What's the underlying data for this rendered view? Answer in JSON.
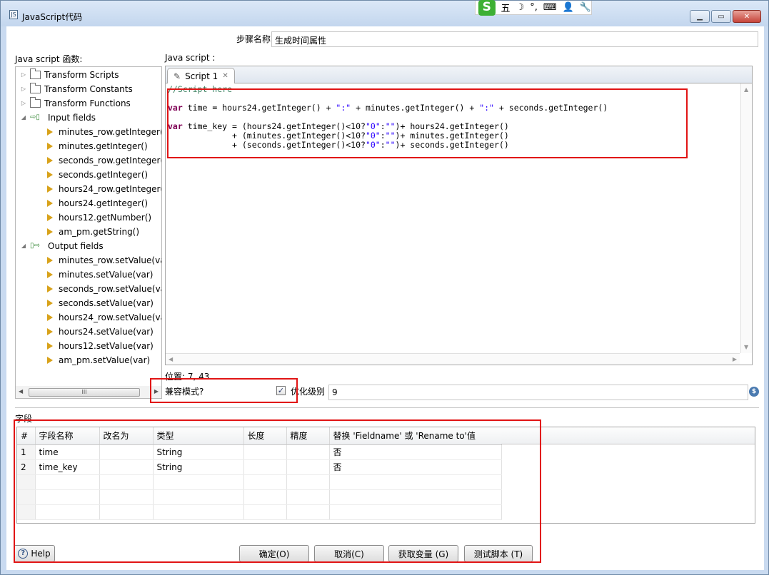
{
  "window": {
    "title": "JavaScript代码",
    "controls": [
      "minimize-icon",
      "maximize-icon",
      "close-icon"
    ]
  },
  "ime_toolbar": {
    "logo": "S",
    "items": [
      "五",
      "☽",
      "°,",
      "⌨",
      "👤",
      "🔧"
    ]
  },
  "step": {
    "label": "步骤名称",
    "value": "生成时间属性"
  },
  "functions_panel": {
    "label": "Java script 函数:",
    "tree": [
      {
        "label": "Transform Scripts",
        "level": 0,
        "kind": "folder",
        "expanded": false
      },
      {
        "label": "Transform Constants",
        "level": 0,
        "kind": "folder",
        "expanded": false
      },
      {
        "label": "Transform Functions",
        "level": 0,
        "kind": "folder",
        "expanded": false
      },
      {
        "label": "Input fields",
        "level": 0,
        "kind": "input",
        "expanded": true
      },
      {
        "label": "minutes_row.getInteger(",
        "level": 1,
        "kind": "leaf"
      },
      {
        "label": "minutes.getInteger()",
        "level": 1,
        "kind": "leaf"
      },
      {
        "label": "seconds_row.getInteger(",
        "level": 1,
        "kind": "leaf"
      },
      {
        "label": "seconds.getInteger()",
        "level": 1,
        "kind": "leaf"
      },
      {
        "label": "hours24_row.getInteger(",
        "level": 1,
        "kind": "leaf"
      },
      {
        "label": "hours24.getInteger()",
        "level": 1,
        "kind": "leaf"
      },
      {
        "label": "hours12.getNumber()",
        "level": 1,
        "kind": "leaf"
      },
      {
        "label": "am_pm.getString()",
        "level": 1,
        "kind": "leaf"
      },
      {
        "label": "Output fields",
        "level": 0,
        "kind": "output",
        "expanded": true
      },
      {
        "label": "minutes_row.setValue(va",
        "level": 1,
        "kind": "leaf"
      },
      {
        "label": "minutes.setValue(var)",
        "level": 1,
        "kind": "leaf"
      },
      {
        "label": "seconds_row.setValue(va",
        "level": 1,
        "kind": "leaf"
      },
      {
        "label": "seconds.setValue(var)",
        "level": 1,
        "kind": "leaf"
      },
      {
        "label": "hours24_row.setValue(va",
        "level": 1,
        "kind": "leaf"
      },
      {
        "label": "hours24.setValue(var)",
        "level": 1,
        "kind": "leaf"
      },
      {
        "label": "hours12.setValue(var)",
        "level": 1,
        "kind": "leaf"
      },
      {
        "label": "am_pm.setValue(var)",
        "level": 1,
        "kind": "leaf"
      }
    ],
    "scroll_thumb": "III"
  },
  "script_panel": {
    "label": "Java script :",
    "tab_label": "Script 1",
    "code_lines": [
      "//Script here",
      "",
      "var time = hours24.getInteger() + \":\" + minutes.getInteger() + \":\" + seconds.getInteger()",
      "",
      "var time_key = (hours24.getInteger()<10?\"0\":\"\")+ hours24.getInteger()",
      "             + (minutes.getInteger()<10?\"0\":\"\")+ minutes.getInteger()",
      "             + (seconds.getInteger()<10?\"0\":\"\")+ seconds.getInteger()"
    ]
  },
  "position": "位置: 7, 43",
  "compat_mode": {
    "label": "兼容模式?",
    "checked": true
  },
  "optimization": {
    "label": "优化级别",
    "value": "9"
  },
  "fields_section": {
    "label": "字段",
    "columns": [
      "#",
      "字段名称",
      "改名为",
      "类型",
      "长度",
      "精度",
      "替换 'Fieldname' 或 'Rename to'值"
    ],
    "rows": [
      [
        "1",
        "time",
        "",
        "String",
        "",
        "",
        "否"
      ],
      [
        "2",
        "time_key",
        "",
        "String",
        "",
        "",
        "否"
      ],
      [
        "",
        "",
        "",
        "",
        "",
        "",
        ""
      ],
      [
        "",
        "",
        "",
        "",
        "",
        "",
        ""
      ],
      [
        "",
        "",
        "",
        "",
        "",
        "",
        ""
      ]
    ]
  },
  "buttons": {
    "help": "Help",
    "ok": "确定(O)",
    "cancel": "取消(C)",
    "get_vars": "获取变量 (G)",
    "test": "测试脚本 (T)"
  },
  "highlight_color": "#e11414"
}
